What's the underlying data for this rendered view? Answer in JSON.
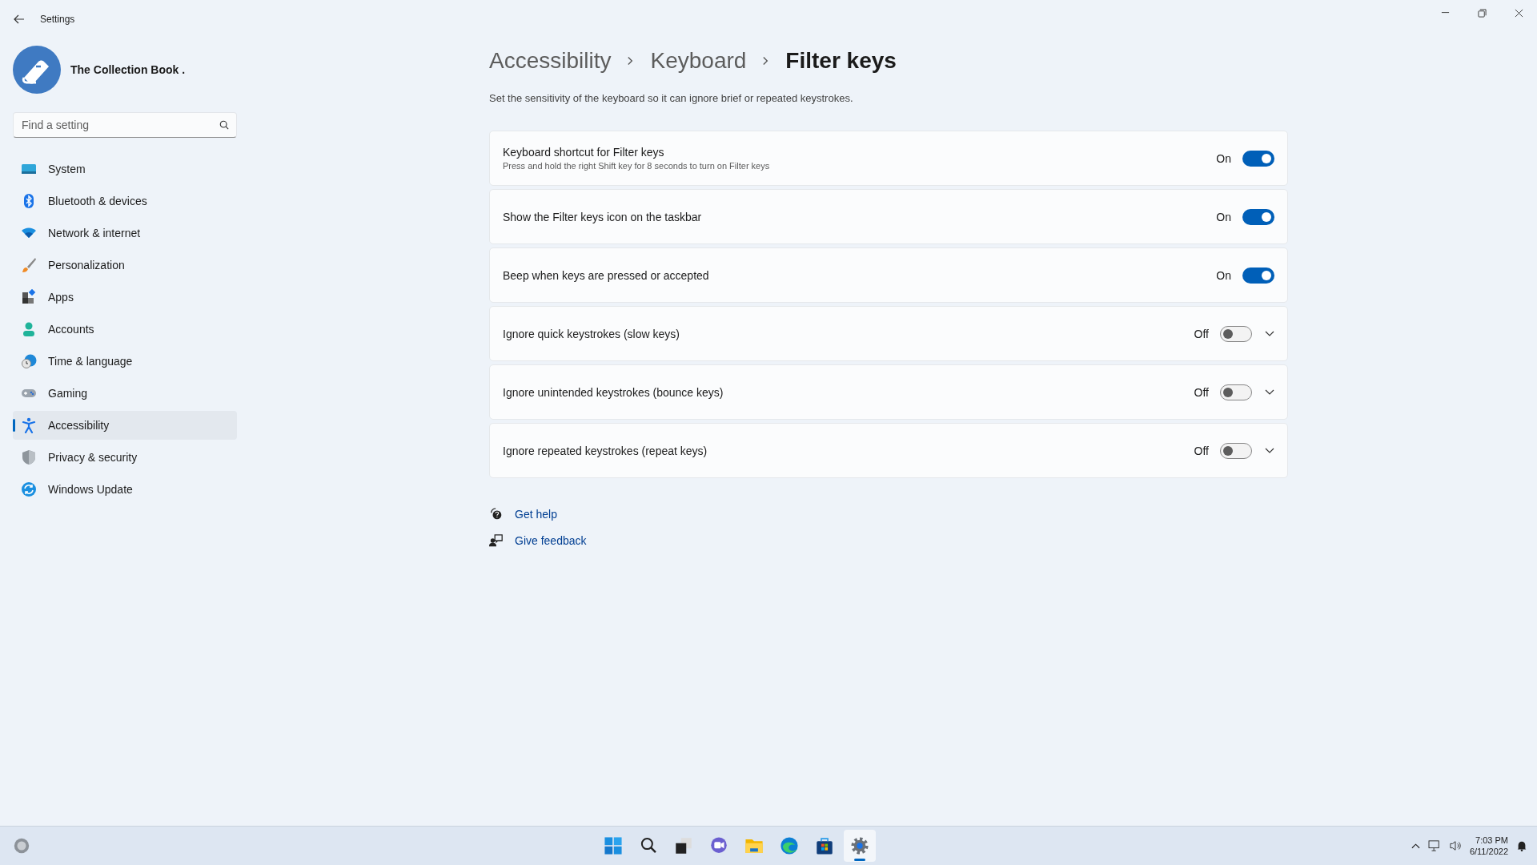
{
  "window": {
    "title": "Settings"
  },
  "profile": {
    "name": "The Collection Book ."
  },
  "search": {
    "placeholder": "Find a setting"
  },
  "nav": [
    {
      "label": "System",
      "kind": "system",
      "selected": false
    },
    {
      "label": "Bluetooth & devices",
      "kind": "bluetooth",
      "selected": false
    },
    {
      "label": "Network & internet",
      "kind": "network",
      "selected": false
    },
    {
      "label": "Personalization",
      "kind": "personalization",
      "selected": false
    },
    {
      "label": "Apps",
      "kind": "apps",
      "selected": false
    },
    {
      "label": "Accounts",
      "kind": "accounts",
      "selected": false
    },
    {
      "label": "Time & language",
      "kind": "time",
      "selected": false
    },
    {
      "label": "Gaming",
      "kind": "gaming",
      "selected": false
    },
    {
      "label": "Accessibility",
      "kind": "accessibility",
      "selected": true
    },
    {
      "label": "Privacy & security",
      "kind": "privacy",
      "selected": false
    },
    {
      "label": "Windows Update",
      "kind": "update",
      "selected": false
    }
  ],
  "breadcrumb": [
    "Accessibility",
    "Keyboard",
    "Filter keys"
  ],
  "description": "Set the sensitivity of the keyboard so it can ignore brief or repeated keystrokes.",
  "settings": [
    {
      "title": "Keyboard shortcut for Filter keys",
      "subtitle": "Press and hold the right Shift key for 8 seconds to turn on Filter keys",
      "state_label": "On",
      "on": true,
      "expandable": false
    },
    {
      "title": "Show the Filter keys icon on the taskbar",
      "state_label": "On",
      "on": true,
      "expandable": false
    },
    {
      "title": "Beep when keys are pressed or accepted",
      "state_label": "On",
      "on": true,
      "expandable": false
    },
    {
      "title": "Ignore quick keystrokes (slow keys)",
      "state_label": "Off",
      "on": false,
      "expandable": true
    },
    {
      "title": "Ignore unintended keystrokes (bounce keys)",
      "state_label": "Off",
      "on": false,
      "expandable": true
    },
    {
      "title": "Ignore repeated keystrokes (repeat keys)",
      "state_label": "Off",
      "on": false,
      "expandable": true
    }
  ],
  "links": [
    {
      "label": "Get help",
      "kind": "help"
    },
    {
      "label": "Give feedback",
      "kind": "feedback"
    }
  ],
  "taskbar": {
    "apps": [
      {
        "kind": "start",
        "selected": false
      },
      {
        "kind": "search",
        "selected": false
      },
      {
        "kind": "taskview",
        "selected": false
      },
      {
        "kind": "chat",
        "selected": false
      },
      {
        "kind": "explorer",
        "selected": false
      },
      {
        "kind": "browser",
        "selected": false
      },
      {
        "kind": "store",
        "selected": false
      },
      {
        "kind": "settings",
        "selected": true
      }
    ],
    "time": "7:03 PM",
    "date": "6/11/2022"
  }
}
